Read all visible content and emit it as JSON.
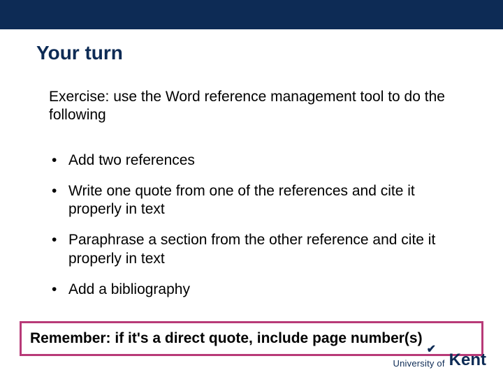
{
  "header": {
    "title": "Your turn"
  },
  "intro": "Exercise: use the Word reference management tool to do the following",
  "bullets": [
    "Add two references",
    "Write one quote from one of the references and cite it properly in text",
    "Paraphrase a section from the other reference and cite it properly in text",
    "Add a bibliography"
  ],
  "callout": "Remember: if it's a direct quote, include page number(s)",
  "footer": {
    "university_prefix": "University of",
    "university_name": "Kent"
  }
}
